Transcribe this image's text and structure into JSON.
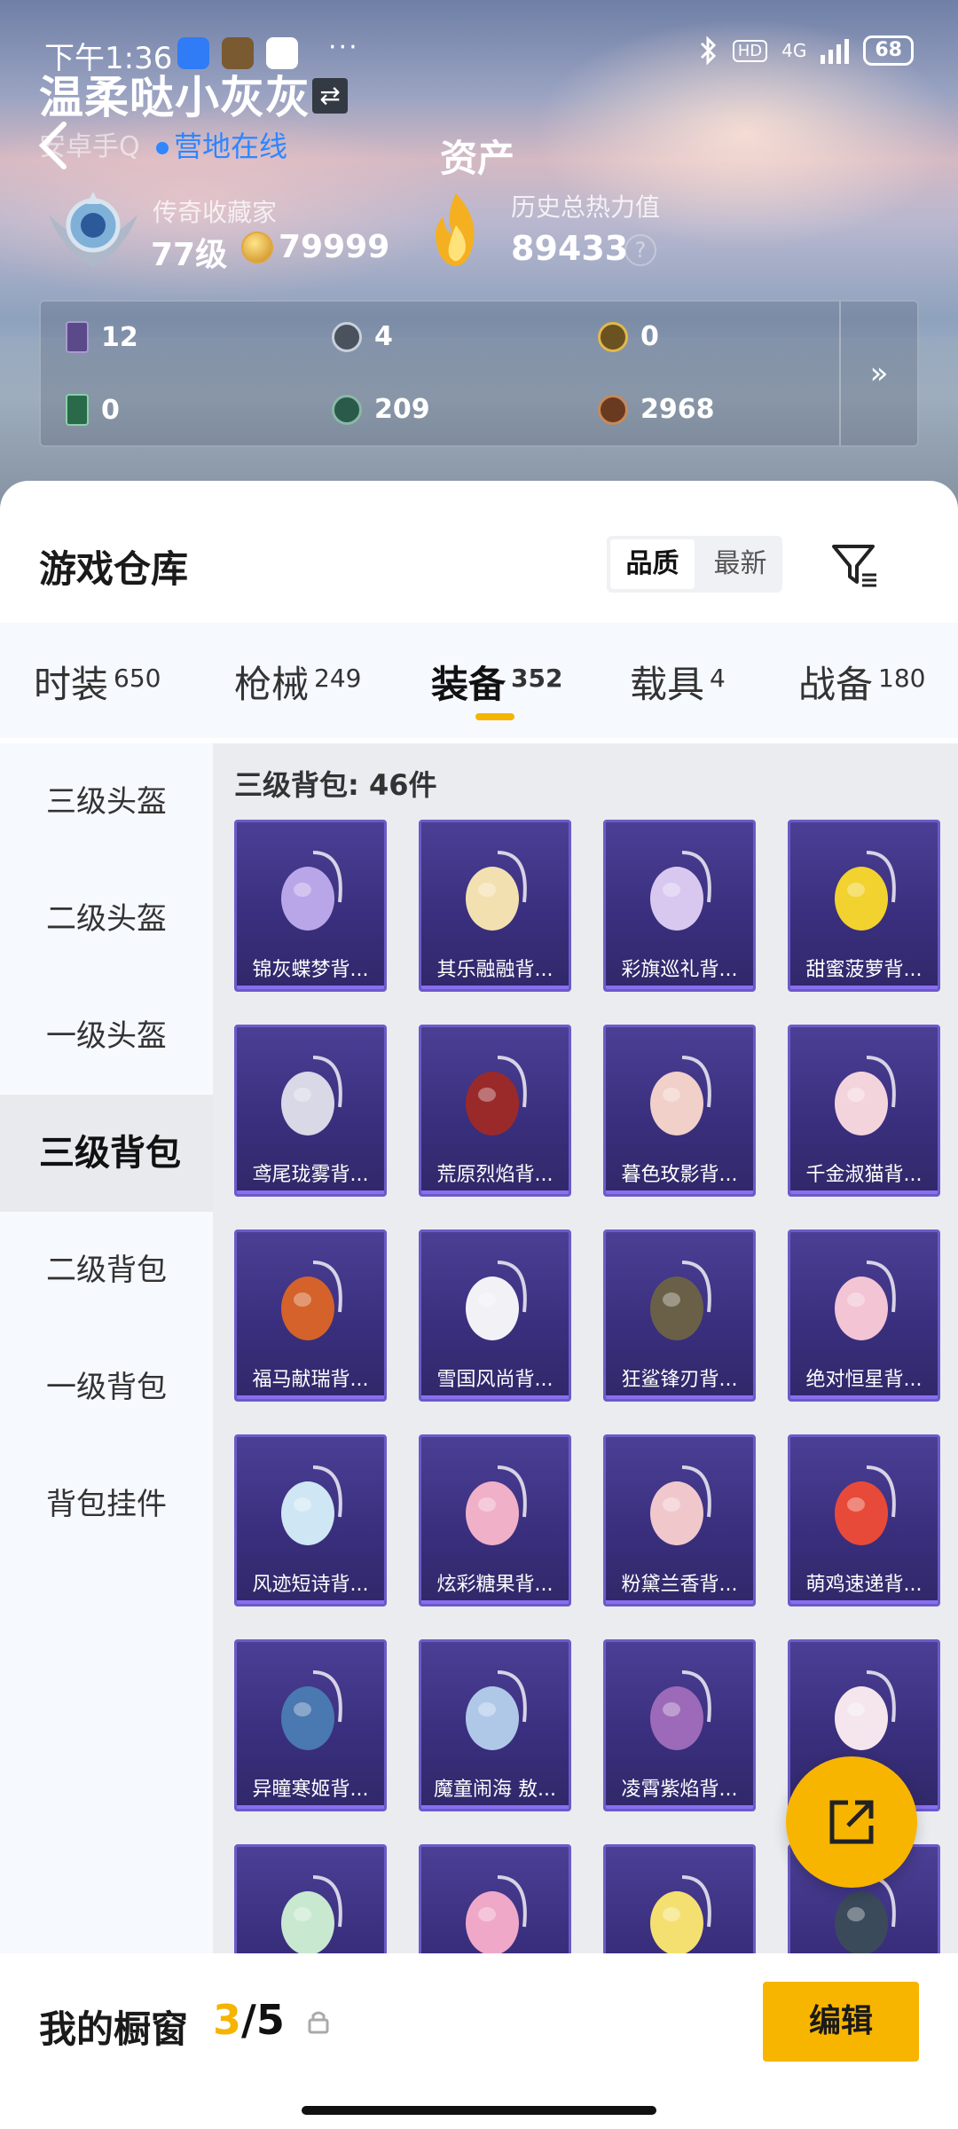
{
  "status_bar": {
    "time": "下午1:36",
    "network": "4G",
    "battery": "68",
    "hd": "HD"
  },
  "header": {
    "username": "温柔哒小灰灰",
    "platform": "安卓手Q",
    "online_status": "营地在线",
    "page_title": "资产",
    "collector_title": "传奇收藏家",
    "level": "77级",
    "coins": "79999",
    "heat_label": "历史总热力值",
    "heat_value": "89433",
    "help": "?"
  },
  "stats": [
    {
      "icon": "purple-card-icon",
      "value": "12"
    },
    {
      "icon": "silver-token-icon",
      "value": "4"
    },
    {
      "icon": "gold-token-icon",
      "value": "0"
    },
    {
      "icon": "green-card-icon",
      "value": "0"
    },
    {
      "icon": "green-token-icon",
      "value": "209"
    },
    {
      "icon": "bronze-token-icon",
      "value": "2968"
    }
  ],
  "stats_more": "»",
  "warehouse": {
    "title": "游戏仓库",
    "sort_quality": "品质",
    "sort_latest": "最新"
  },
  "tabs": [
    {
      "label": "时装",
      "count": "650"
    },
    {
      "label": "枪械",
      "count": "249"
    },
    {
      "label": "装备",
      "count": "352"
    },
    {
      "label": "载具",
      "count": "4"
    },
    {
      "label": "战备",
      "count": "180"
    }
  ],
  "sidebar": [
    {
      "label": "三级头盔"
    },
    {
      "label": "二级头盔"
    },
    {
      "label": "一级头盔"
    },
    {
      "label": "三级背包"
    },
    {
      "label": "二级背包"
    },
    {
      "label": "一级背包"
    },
    {
      "label": "背包挂件"
    }
  ],
  "section_title": "三级背包: 46件",
  "items": [
    {
      "name": "锦灰蝶梦背...",
      "color": "#b8a6e8"
    },
    {
      "name": "其乐融融背...",
      "color": "#f3e0b0"
    },
    {
      "name": "彩旗巡礼背...",
      "color": "#d8c8f0"
    },
    {
      "name": "甜蜜菠萝背...",
      "color": "#f2d22e"
    },
    {
      "name": "鸢尾珑雾背...",
      "color": "#d8d8e6"
    },
    {
      "name": "荒原烈焰背...",
      "color": "#9a2a2a"
    },
    {
      "name": "暮色玫影背...",
      "color": "#f0d0c8"
    },
    {
      "name": "千金淑猫背...",
      "color": "#f4d4dc"
    },
    {
      "name": "福马献瑞背...",
      "color": "#d4622a"
    },
    {
      "name": "雪国风尚背...",
      "color": "#f2f2f6"
    },
    {
      "name": "狂鲨锋刃背...",
      "color": "#6a6048"
    },
    {
      "name": "绝对恒星背...",
      "color": "#f2c4d4"
    },
    {
      "name": "风迹短诗背...",
      "color": "#cfe6f4"
    },
    {
      "name": "炫彩糖果背...",
      "color": "#f0b0c8"
    },
    {
      "name": "粉黛兰香背...",
      "color": "#f0c8cc"
    },
    {
      "name": "萌鸡速递背...",
      "color": "#e84a3a"
    },
    {
      "name": "异瞳寒姬背...",
      "color": "#4a78b0"
    },
    {
      "name": "魔童闹海 敖...",
      "color": "#b0c8e8"
    },
    {
      "name": "凌霄紫焰背...",
      "color": "#9c6ab8"
    },
    {
      "name": "",
      "color": "#f4e6ec"
    },
    {
      "name": "",
      "color": "#c8e8d0"
    },
    {
      "name": "",
      "color": "#f0a8c8"
    },
    {
      "name": "",
      "color": "#f4e070"
    },
    {
      "name": "",
      "color": "#3a4a5a"
    }
  ],
  "bottom": {
    "showcase_label": "我的橱窗",
    "showcase_current": "3",
    "showcase_total": "/5",
    "edit_label": "编辑"
  }
}
